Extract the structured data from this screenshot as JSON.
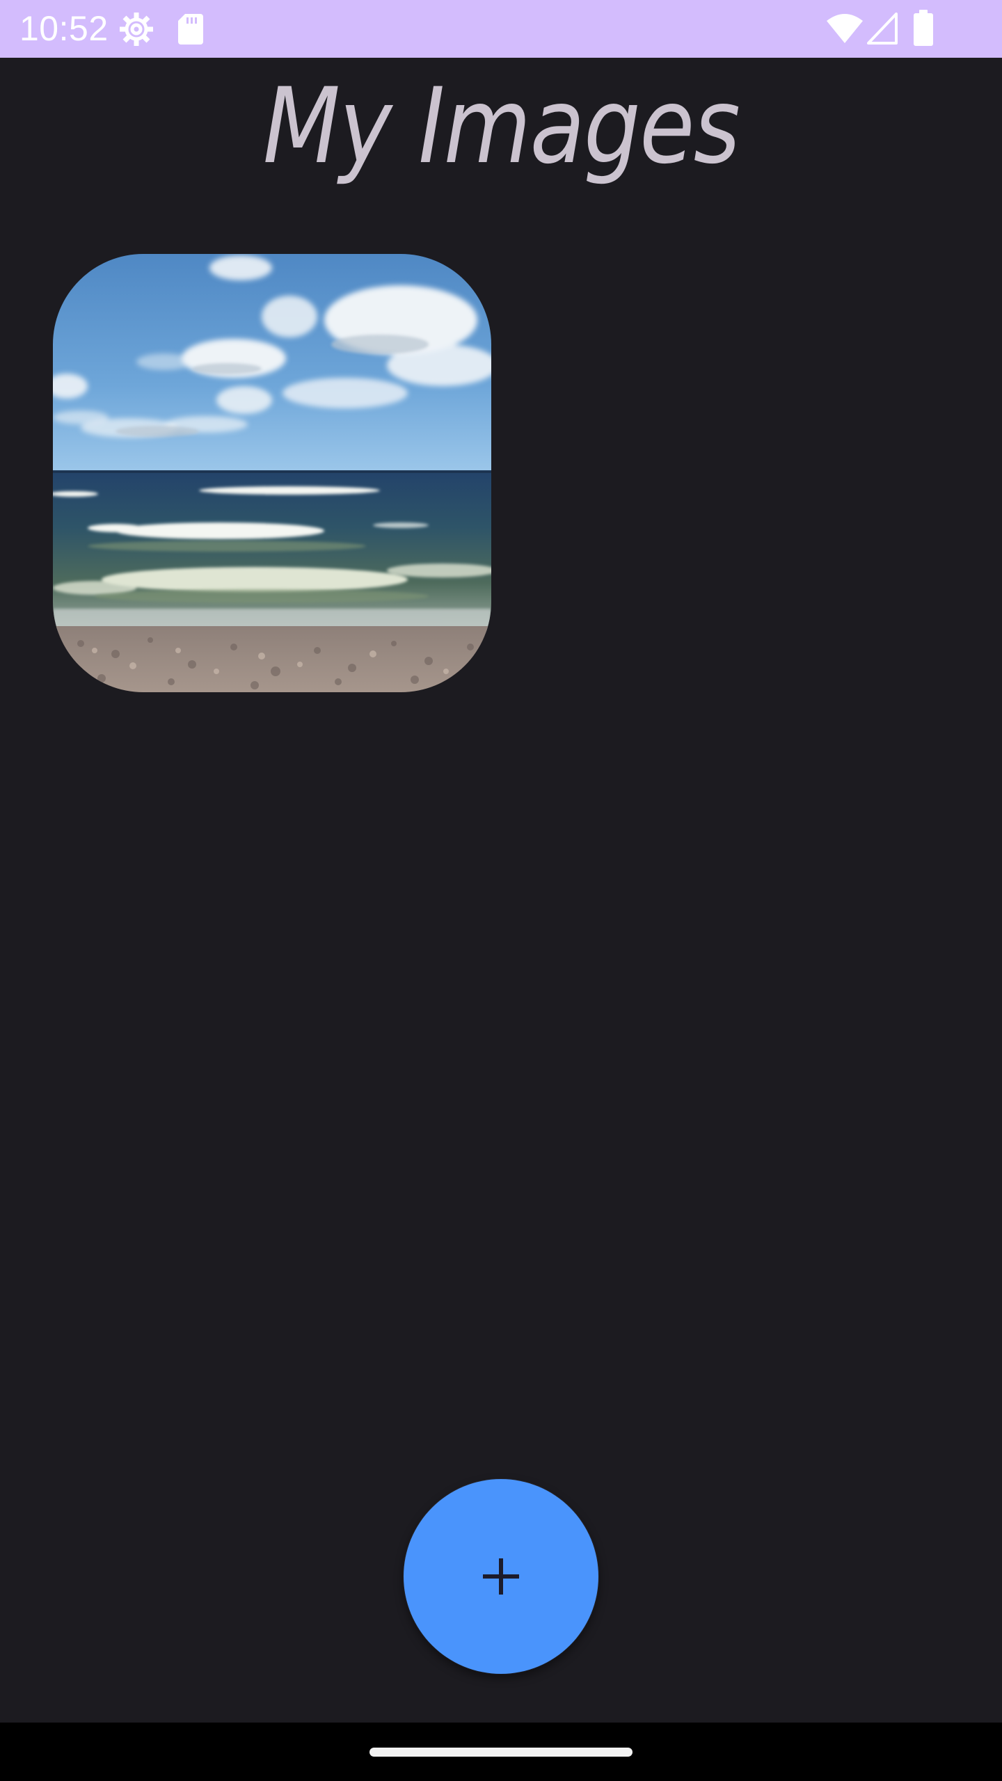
{
  "status_bar": {
    "time": "10:52",
    "background_color": "#d3bcfd",
    "icons": [
      "settings-gear-icon",
      "sd-card-icon",
      "wifi-icon",
      "cellular-signal-icon",
      "battery-icon"
    ]
  },
  "header": {
    "title": "My Images",
    "title_color": "#cbc3cf"
  },
  "gallery": {
    "background_color": "#1c1b20",
    "images": [
      {
        "subject": "sea-waves-beach-photo"
      }
    ]
  },
  "fab": {
    "icon": "plus-icon",
    "color": "#4a94fc"
  },
  "navigation": {
    "handle": "gesture-handle"
  }
}
